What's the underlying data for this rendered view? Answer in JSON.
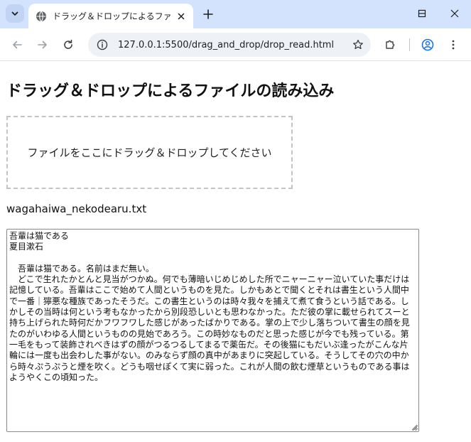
{
  "browser": {
    "tab_title": "ドラッグ＆ドロップによるファイルの読",
    "url": "127.0.0.1:5500/drag_and_drop/drop_read.html",
    "colors": {
      "tabstrip": "#d3e3fd",
      "omnibox": "#eef1f6"
    }
  },
  "page": {
    "title": "ドラッグ＆ドロップによるファイルの読み込み",
    "dropzone_text": "ファイルをここにドラッグ＆ドロップしてください",
    "filename": "wagahaiwa_nekodearu.txt",
    "file_content": "吾輩は猫である\n夏目漱石\n\n　吾輩は猫である。名前はまだ無い。\n　どこで生れたかとんと見当がつかぬ。何でも薄暗いじめじめした所でニャーニャー泣いていた事だけは記憶している。吾輩はここで始めて人間というものを見た。しかもあとで聞くとそれは書生という人間中で一番｜獰悪な種族であったそうだ。この書生というのは時々我々を捕えて煮て食うという話である。しかしその当時は何という考もなかったから別段恐しいとも思わなかった。ただ彼の掌に載せられてスーと持ち上げられた時何だかフワフワした感じがあったばかりである。掌の上で少し落ちついて書生の顔を見たのがいわゆる人間というものの見始であろう。この時妙なものだと思った感じが今でも残っている。第一毛をもって装飾されべきはずの顔がつるつるしてまるで薬缶だ。その後猫にもだいぶ逢ったがこんな片輪には一度も出会わした事がない。のみならず顔の真中があまりに突起している。そうしてその穴の中から時々ぷうぷうと煙を吹く。どうも咽せぽくて実に弱った。これが人間の飲む煙草というものである事はようやくこの頃知った。"
  }
}
